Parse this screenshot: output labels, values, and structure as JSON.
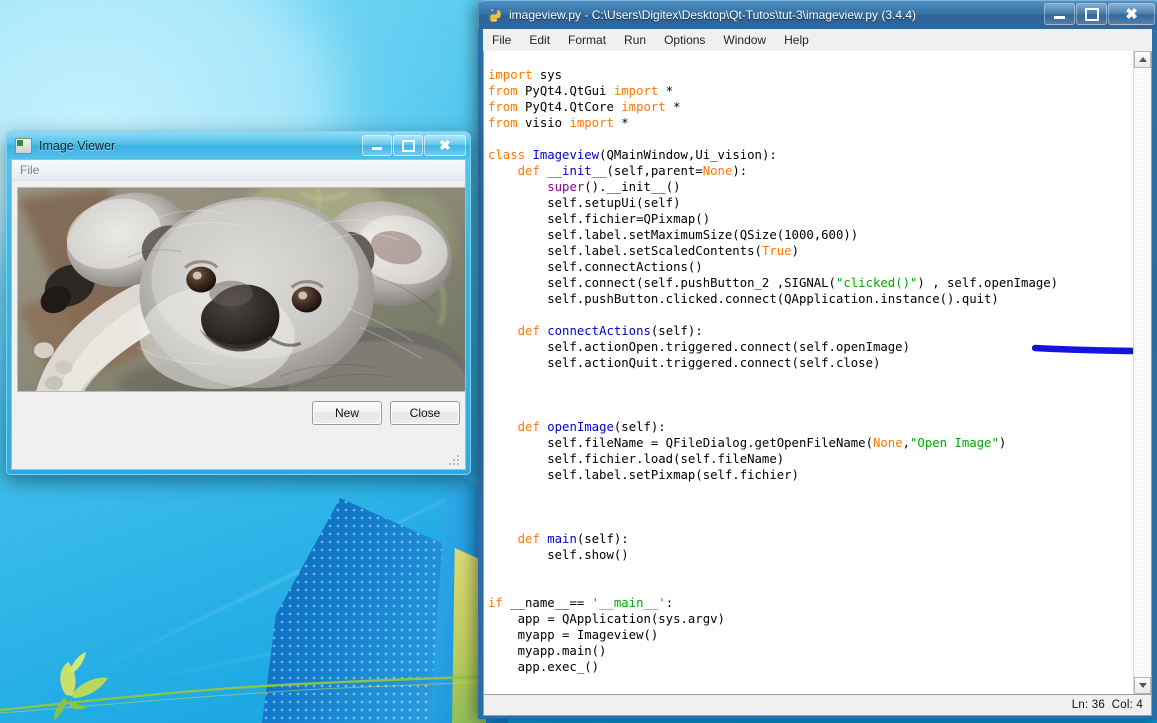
{
  "desktop": {
    "wallpaper_name": "windows-7-harmony-wallpaper",
    "colors": {
      "sky_light": "#6fd6f3",
      "sky_deep": "#0d95d6",
      "ribbon_blue": "#0b63b8",
      "leaf_green": "#8fc640"
    }
  },
  "idle_window": {
    "title": "imageview.py - C:\\Users\\Digitex\\Desktop\\Qt-Tutos\\tut-3\\imageview.py (3.4.4)",
    "icon": "python-idle-icon",
    "window_buttons": {
      "minimize": "–",
      "maximize": "□",
      "close": "✕"
    },
    "menubar": [
      "File",
      "Edit",
      "Format",
      "Run",
      "Options",
      "Window",
      "Help"
    ],
    "statusbar": {
      "line_label": "Ln: 36",
      "col_label": "Col: 4"
    },
    "scrollbar": {
      "up_arrow": "▲",
      "down_arrow": "▼"
    },
    "annotation": {
      "type": "hand-drawn-underline",
      "color": "#1414e0",
      "target_line": "self.pushButton.clicked.connect(QApplication.instance().quit)"
    },
    "code_lines": [
      [
        {
          "t": "import",
          "c": "kw"
        },
        {
          "t": " sys",
          "c": ""
        }
      ],
      [
        {
          "t": "from",
          "c": "kw"
        },
        {
          "t": " PyQt4.QtGui ",
          "c": ""
        },
        {
          "t": "import",
          "c": "kw"
        },
        {
          "t": " *",
          "c": ""
        }
      ],
      [
        {
          "t": "from",
          "c": "kw"
        },
        {
          "t": " PyQt4.QtCore ",
          "c": ""
        },
        {
          "t": "import",
          "c": "kw"
        },
        {
          "t": " *",
          "c": ""
        }
      ],
      [
        {
          "t": "from",
          "c": "kw"
        },
        {
          "t": " visio ",
          "c": ""
        },
        {
          "t": "import",
          "c": "kw"
        },
        {
          "t": " *",
          "c": ""
        }
      ],
      [],
      [
        {
          "t": "class",
          "c": "kw"
        },
        {
          "t": " ",
          "c": ""
        },
        {
          "t": "Imageview",
          "c": "def"
        },
        {
          "t": "(QMainWindow,Ui_vision):",
          "c": ""
        }
      ],
      [
        {
          "t": "    ",
          "c": ""
        },
        {
          "t": "def",
          "c": "kw"
        },
        {
          "t": " ",
          "c": ""
        },
        {
          "t": "__init__",
          "c": "def"
        },
        {
          "t": "(self,parent=",
          "c": ""
        },
        {
          "t": "None",
          "c": "kwarg"
        },
        {
          "t": "):",
          "c": ""
        }
      ],
      [
        {
          "t": "        ",
          "c": ""
        },
        {
          "t": "super",
          "c": "bi"
        },
        {
          "t": "().__init__()",
          "c": ""
        }
      ],
      [
        {
          "t": "        self.setupUi(self)",
          "c": ""
        }
      ],
      [
        {
          "t": "        self.fichier=QPixmap()",
          "c": ""
        }
      ],
      [
        {
          "t": "        self.label.setMaximumSize(QSize(1000,600))",
          "c": ""
        }
      ],
      [
        {
          "t": "        self.label.setScaledContents(",
          "c": ""
        },
        {
          "t": "True",
          "c": "kwarg"
        },
        {
          "t": ")",
          "c": ""
        }
      ],
      [
        {
          "t": "        self.connectActions()",
          "c": ""
        }
      ],
      [
        {
          "t": "        self.connect(self.pushButton_2 ,SIGNAL(",
          "c": ""
        },
        {
          "t": "\"clicked()\"",
          "c": "str"
        },
        {
          "t": ") , self.openImage)",
          "c": ""
        }
      ],
      [
        {
          "t": "        self.pushButton.clicked.connect(QApplication.instance().quit)",
          "c": ""
        }
      ],
      [],
      [
        {
          "t": "    ",
          "c": ""
        },
        {
          "t": "def",
          "c": "kw"
        },
        {
          "t": " ",
          "c": ""
        },
        {
          "t": "connectActions",
          "c": "def"
        },
        {
          "t": "(self):",
          "c": ""
        }
      ],
      [
        {
          "t": "        self.actionOpen.triggered.connect(self.openImage)",
          "c": ""
        }
      ],
      [
        {
          "t": "        self.actionQuit.triggered.connect(self.close)",
          "c": ""
        }
      ],
      [],
      [],
      [],
      [
        {
          "t": "    ",
          "c": ""
        },
        {
          "t": "def",
          "c": "kw"
        },
        {
          "t": " ",
          "c": ""
        },
        {
          "t": "openImage",
          "c": "def"
        },
        {
          "t": "(self):",
          "c": ""
        }
      ],
      [
        {
          "t": "        self.fileName = QFileDialog.getOpenFileName(",
          "c": ""
        },
        {
          "t": "None",
          "c": "kwarg"
        },
        {
          "t": ",",
          "c": ""
        },
        {
          "t": "\"Open Image\"",
          "c": "str"
        },
        {
          "t": ")",
          "c": ""
        }
      ],
      [
        {
          "t": "        self.fichier.load(self.fileName)",
          "c": ""
        }
      ],
      [
        {
          "t": "        self.label.setPixmap(self.fichier)",
          "c": ""
        }
      ],
      [],
      [],
      [],
      [
        {
          "t": "    ",
          "c": ""
        },
        {
          "t": "def",
          "c": "kw"
        },
        {
          "t": " ",
          "c": ""
        },
        {
          "t": "main",
          "c": "def"
        },
        {
          "t": "(self):",
          "c": ""
        }
      ],
      [
        {
          "t": "        self.show()",
          "c": ""
        }
      ],
      [],
      [],
      [
        {
          "t": "if",
          "c": "kw"
        },
        {
          "t": " __name__== ",
          "c": ""
        },
        {
          "t": "'__main__'",
          "c": "str"
        },
        {
          "t": ":",
          "c": ""
        }
      ],
      [
        {
          "t": "    app = QApplication(sys.argv)",
          "c": ""
        }
      ],
      [
        {
          "t": "    myapp = Imageview()",
          "c": ""
        }
      ],
      [
        {
          "t": "    myapp.main()",
          "c": ""
        }
      ],
      [
        {
          "t": "    app.exec_()",
          "c": ""
        }
      ]
    ]
  },
  "viewer_window": {
    "title": "Image Viewer",
    "icon": "image-viewer-icon",
    "window_buttons": {
      "minimize": "–",
      "maximize": "□",
      "close": "✕"
    },
    "menubar": [
      "File"
    ],
    "image": {
      "alt": "koala-photograph"
    },
    "buttons": [
      {
        "name": "new-button",
        "label": "New"
      },
      {
        "name": "close-button",
        "label": "Close"
      }
    ],
    "resize_grip": "resize-grip-icon"
  }
}
